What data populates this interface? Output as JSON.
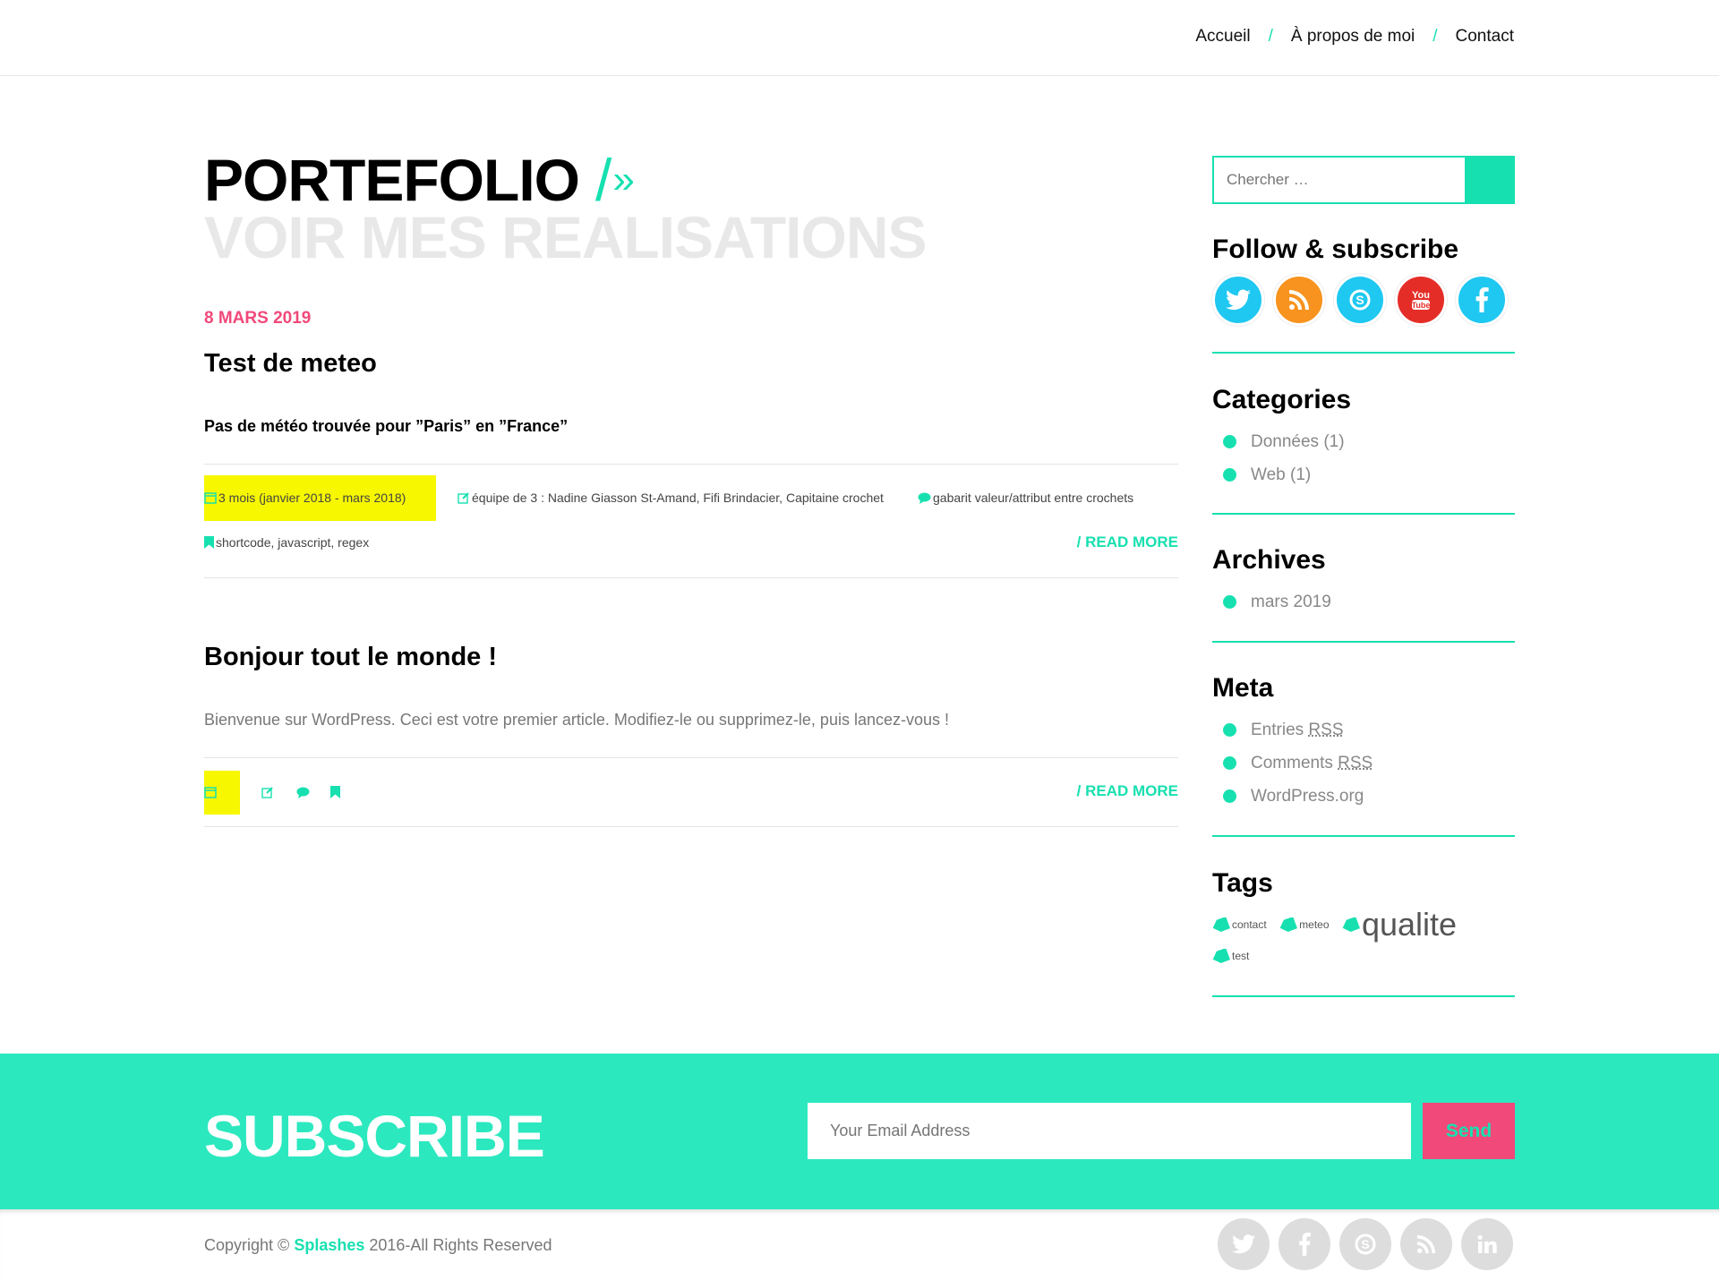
{
  "nav": {
    "items": [
      "Accueil",
      "À propos de moi",
      "Contact"
    ],
    "separator": "/"
  },
  "hero": {
    "title": "PORTEFOLIO",
    "slash": "/",
    "chevron": "»",
    "subtitle": "VOIR MES REALISATIONS"
  },
  "posts": [
    {
      "date": "8 MARS 2019",
      "title": "Test de meteo",
      "lead": "Pas de météo trouvée pour ”Paris” en ”France”",
      "duration": "3 mois (janvier 2018 - mars 2018)",
      "team": "équipe de 3 : Nadine Giasson St-Amand, Fifi Brindacier, Capitaine crochet",
      "comment": "gabarit valeur/attribut entre crochets",
      "tags": "shortcode, javascript, regex",
      "read_more": "/ READ MORE"
    },
    {
      "title": "Bonjour tout le monde !",
      "excerpt": "Bienvenue sur WordPress. Ceci est votre premier article. Modifiez-le ou supprimez-le, puis lancez-vous !",
      "read_more": "/ READ MORE"
    }
  ],
  "sidebar": {
    "search_placeholder": "Chercher …",
    "follow_title": "Follow & subscribe",
    "social": [
      {
        "icon": "twitter-icon",
        "color": "#1fc8f0"
      },
      {
        "icon": "rss-icon",
        "color": "#f7931e"
      },
      {
        "icon": "skype-icon",
        "color": "#1fc8f0"
      },
      {
        "icon": "youtube-icon",
        "color": "#e52d27"
      },
      {
        "icon": "facebook-icon",
        "color": "#1fc8f0"
      }
    ],
    "categories_title": "Categories",
    "categories": [
      {
        "name": "Données",
        "count": "(1)"
      },
      {
        "name": "Web",
        "count": "(1)"
      }
    ],
    "archives_title": "Archives",
    "archives": [
      "mars 2019"
    ],
    "meta_title": "Meta",
    "meta": [
      {
        "prefix": "Entries ",
        "abbr": "RSS"
      },
      {
        "prefix": "Comments ",
        "abbr": "RSS"
      },
      {
        "prefix": "WordPress.org",
        "abbr": ""
      }
    ],
    "tags_title": "Tags",
    "tags": [
      "contact",
      "meteo",
      "qualite",
      "test"
    ]
  },
  "subscribe": {
    "title": "SUBSCRIBE",
    "placeholder": "Your Email Address",
    "button": "Send"
  },
  "footer": {
    "prefix": "Copyright © ",
    "brand": "Splashes",
    "suffix": " 2016-All Rights Reserved",
    "social": [
      "twitter-icon",
      "facebook-icon",
      "skype-icon",
      "rss-icon",
      "linkedin-icon"
    ]
  },
  "colors": {
    "accent": "#17e0b0",
    "pink": "#f0497a",
    "highlight": "#f7f700"
  }
}
